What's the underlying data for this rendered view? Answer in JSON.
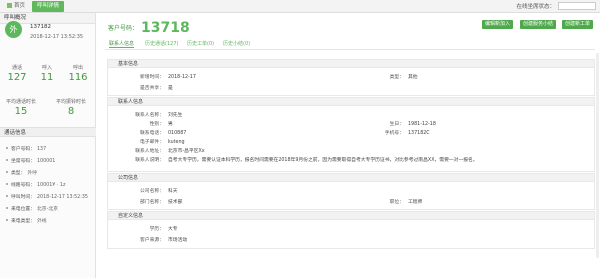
{
  "topbar": {
    "tabs": [
      "首页",
      "呼叫详情"
    ],
    "online_status_label": "在线坐席状态："
  },
  "left": {
    "header": "呼叫概况",
    "avatar_text": "外",
    "phone": "137182",
    "time": "2018-12-17 13:52:35",
    "stats_row1": [
      {
        "label": "通话",
        "value": "127"
      },
      {
        "label": "呼入",
        "value": "11"
      },
      {
        "label": "呼出",
        "value": "116"
      }
    ],
    "stats_row2": [
      {
        "label": "平均通话时长",
        "value": "15"
      },
      {
        "label": "平均振铃时长",
        "value": "8"
      }
    ],
    "info_header": "通话信息",
    "info": [
      {
        "k": "客户号码：",
        "v": "137"
      },
      {
        "k": "坐席号码：",
        "v": "100001"
      },
      {
        "k": "类型：",
        "v": "外呼"
      },
      {
        "k": "线路号码：",
        "v": "10001¥ · 1z"
      },
      {
        "k": "呼叫时间：",
        "v": "2018-12-17 13:52:35"
      },
      {
        "k": "来电位置：",
        "v": "北京-北京"
      },
      {
        "k": "来电类型：",
        "v": "外线"
      }
    ]
  },
  "main": {
    "customer_label": "客户号码：",
    "customer_number": "13718",
    "buttons": [
      "编辑新加入",
      "创建服务小结",
      "创建新工单"
    ],
    "subtabs": [
      "联系人信息",
      "历史通话(127)",
      "历史工单(0)",
      "历史小结(0)"
    ],
    "basic": {
      "title": "基本信息",
      "create_time_label": "新增时间：",
      "create_time": "2018-12-17",
      "type_label": "类型：",
      "type": "其他",
      "shared_label": "是否共享：",
      "shared": "是"
    },
    "contact": {
      "title": "联系人信息",
      "name_label": "联系人名称：",
      "name": "刘先生",
      "gender_label": "性别：",
      "gender": "男",
      "birthday_label": "生日：",
      "birthday": "1981-12-18",
      "phone_label": "联系电话：",
      "phone": "010887",
      "mobile_label": "手机号：",
      "mobile": "137182C",
      "email_label": "电子邮件：",
      "email": "kuteng",
      "address_label": "联系人地址：",
      "address": "北京市-昌平区Xx",
      "note_label": "联系人说明：",
      "note": "自考大专学历，需要认证本科学历，报名时间需要在2018年9月份之前，因为需要取得自考大专学历证书，对比参考过南昌XX，需要一对一报名。"
    },
    "company": {
      "title": "公司信息",
      "company_label": "公司名称：",
      "company": "科天",
      "dept_label": "部门名称：",
      "dept": "技术部",
      "position_label": "职位：",
      "position": "工程师"
    },
    "custom": {
      "title": "自定义信息",
      "edu_label": "学历：",
      "edu": "大专",
      "source_label": "客户来源：",
      "source": "市场活动"
    }
  }
}
